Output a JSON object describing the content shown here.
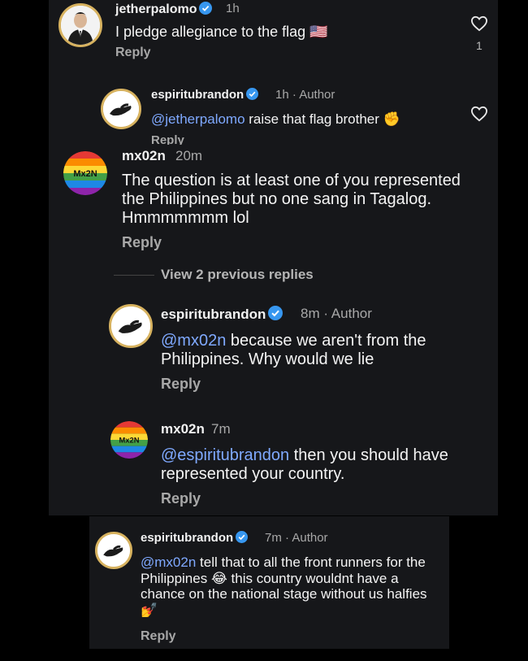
{
  "comments": [
    {
      "username": "jetherpalomo",
      "time": "1h",
      "text": "I pledge allegiance to the flag",
      "emoji": "🇺🇸",
      "reply": "Reply",
      "likes": "1"
    },
    {
      "username": "espiritubrandon",
      "time": "1h",
      "author": "Author",
      "mention": "@jetherpalomo",
      "text": " raise that flag brother",
      "emoji": "✊",
      "reply": "Reply"
    },
    {
      "username": "mx02n",
      "time": "20m",
      "text": "The question is at least one of you represented the Philippines but no one sang in Tagalog. Hmmmmmmm lol",
      "reply": "Reply",
      "view_replies": "View 2 previous replies"
    },
    {
      "username": "espiritubrandon",
      "time": "8m",
      "author": "Author",
      "mention": "@mx02n",
      "text": " because we aren't from the Philippines. Why would we lie",
      "reply": "Reply"
    },
    {
      "username": "mx02n",
      "time": "7m",
      "mention": "@espiritubrandon",
      "text": " then you should have represented your country.",
      "reply": "Reply"
    },
    {
      "username": "espiritubrandon",
      "time": "7m",
      "author": "Author",
      "mention": "@mx02n",
      "text_a": " tell that to all the front runners for the Philippines ",
      "emoji_a": "😂",
      "text_b": " this country wouldnt have a chance on the national stage without us halfies ",
      "emoji_b": "💅",
      "reply": "Reply"
    }
  ],
  "avatar_text": "Mx2N",
  "colors": {
    "background": "#000000",
    "panel": "#16171a",
    "muted_text": "#a8a8a8",
    "mention": "#7fa9ff",
    "verified": "#3797f0",
    "story_ring": "#d7b25f"
  }
}
